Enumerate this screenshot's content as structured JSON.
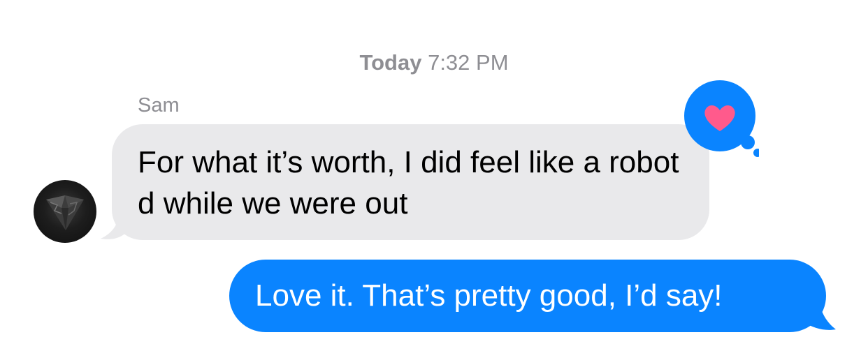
{
  "conversation": {
    "timestamp_day": "Today",
    "timestamp_time": "7:32 PM",
    "sender_name": "Sam"
  },
  "messages": [
    {
      "direction": "incoming",
      "text": "For what it’s worth, I did feel like a robot d while we were out",
      "reaction": "heart-icon"
    },
    {
      "direction": "outgoing",
      "text": "Love it. That’s pretty good, I’d say!"
    }
  ],
  "colors": {
    "incoming_bubble": "#e9e9eb",
    "outgoing_bubble": "#0a84ff",
    "reaction_heart": "#ff5a8c",
    "meta_text": "#8e8e93"
  }
}
